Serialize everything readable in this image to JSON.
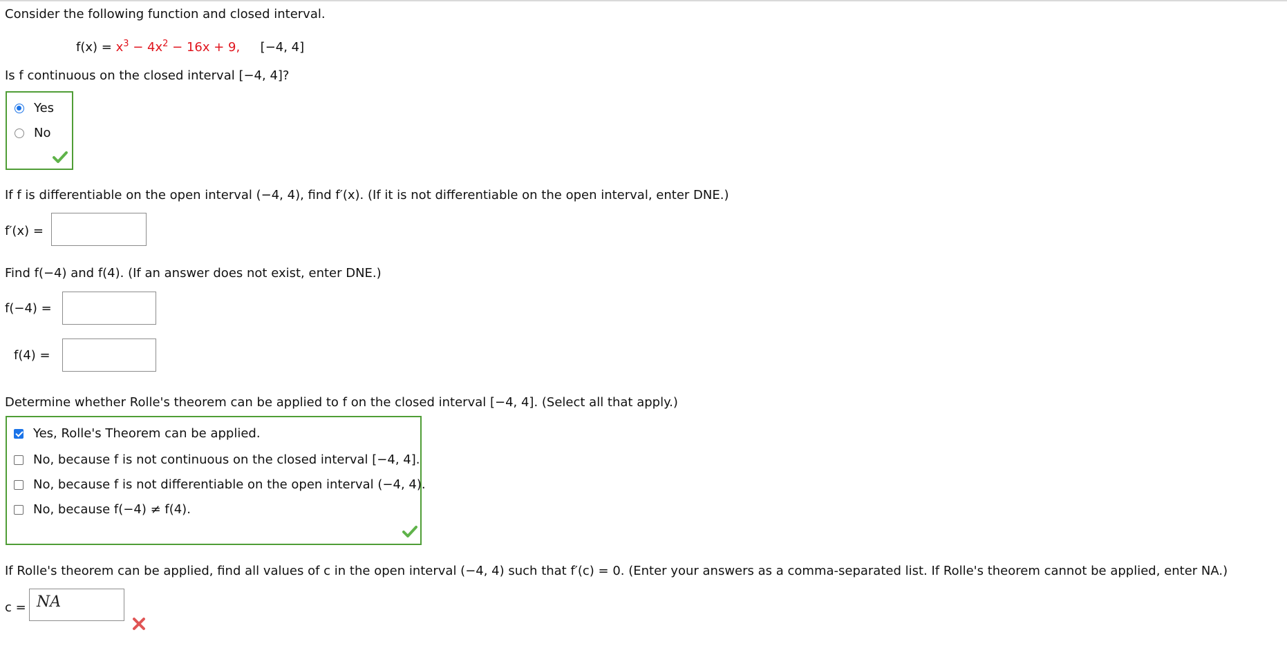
{
  "intro": "Consider the following function and closed interval.",
  "function_line": {
    "lhs": "f(x) = ",
    "expr": {
      "t1": "x",
      "sup1": "3",
      "t2": " − 4x",
      "sup2": "2",
      "t3": " − 16x + 9,"
    },
    "interval": "[−4, 4]"
  },
  "q1": {
    "prompt": "Is f continuous on the closed interval [−4, 4]?",
    "options": [
      "Yes",
      "No"
    ],
    "selected": "Yes"
  },
  "q2": {
    "prompt": "If f is differentiable on the open interval (−4, 4), find f′(x). (If it is not differentiable on the open interval, enter DNE.)",
    "label": "f′(x) =",
    "value": ""
  },
  "q3": {
    "prompt": "Find f(−4) and f(4). (If an answer does not exist, enter DNE.)",
    "label_a": "f(−4)  =",
    "label_b": "f(4)  =",
    "value_a": "",
    "value_b": ""
  },
  "q4": {
    "prompt": "Determine whether Rolle's theorem can be applied to f on the closed interval [−4, 4]. (Select all that apply.)",
    "options": [
      "Yes, Rolle's Theorem can be applied.",
      "No, because f is not continuous on the closed interval [−4, 4].",
      "No, because f is not differentiable on the open interval (−4, 4).",
      "No, because f(−4) ≠ f(4)."
    ],
    "checked": [
      true,
      false,
      false,
      false
    ]
  },
  "q5": {
    "prompt": "If Rolle's theorem can be applied, find all values of c in the open interval (−4, 4) such that f′(c) = 0. (Enter your answers as a comma-separated list. If Rolle's theorem cannot be applied, enter NA.)",
    "label": "c =",
    "value": "NA"
  },
  "colors": {
    "correct_green": "#4f9d36",
    "wrong_red": "#e05555",
    "select_blue": "#1a73e8",
    "function_red": "#e0141d"
  },
  "icons": {
    "correct": "check-mark-icon",
    "incorrect": "cross-mark-icon"
  }
}
